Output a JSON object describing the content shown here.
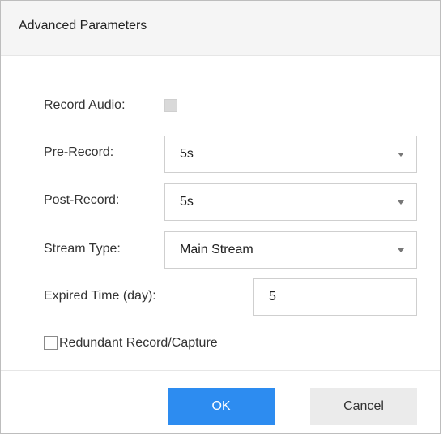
{
  "dialog": {
    "title": "Advanced Parameters"
  },
  "fields": {
    "record_audio": {
      "label": "Record Audio:",
      "checked": false,
      "enabled": false
    },
    "pre_record": {
      "label": "Pre-Record:",
      "value": "5s"
    },
    "post_record": {
      "label": "Post-Record:",
      "value": "5s"
    },
    "stream_type": {
      "label": "Stream Type:",
      "value": "Main Stream"
    },
    "expired_time": {
      "label": "Expired Time (day):",
      "value": "5"
    },
    "redundant": {
      "label": "Redundant Record/Capture",
      "checked": false
    }
  },
  "buttons": {
    "ok_label": "OK",
    "cancel_label": "Cancel"
  },
  "colors": {
    "primary": "#2d8cf0",
    "secondary_button": "#ebebeb",
    "header_background": "#f5f5f5",
    "border": "#cfcfcf"
  },
  "icons": {
    "dropdown": "chevron-down-icon"
  }
}
